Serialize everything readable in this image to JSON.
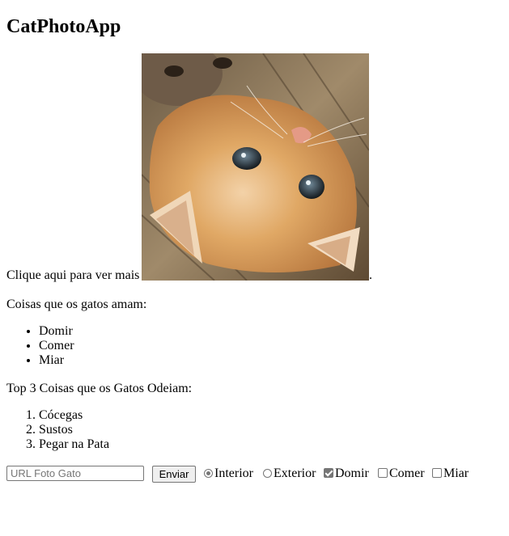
{
  "app": {
    "title": "CatPhotoApp"
  },
  "photo": {
    "link_text": "Clique aqui para ver mais",
    "image_alt": "kitten-lying-upside-down-photo",
    "trailing_text": "."
  },
  "loves": {
    "heading": "Coisas que os gatos amam:",
    "items": [
      "Domir",
      "Comer",
      "Miar"
    ]
  },
  "hates": {
    "heading": "Top 3 Coisas que os Gatos Odeiam:",
    "items": [
      "Cócegas",
      "Sustos",
      "Pegar na Pata"
    ]
  },
  "form": {
    "url_input": {
      "value": "",
      "placeholder": "URL Foto Gato"
    },
    "submit_label": "Enviar",
    "radios": [
      {
        "label": "Interior",
        "checked": true
      },
      {
        "label": "Exterior",
        "checked": false
      }
    ],
    "checkboxes": [
      {
        "label": "Domir",
        "checked": true
      },
      {
        "label": "Comer",
        "checked": false
      },
      {
        "label": "Miar",
        "checked": false
      }
    ]
  },
  "colors": {
    "control_border": "#767676",
    "button_bg": "#efefef",
    "photo_fur": "#d99a5c"
  }
}
